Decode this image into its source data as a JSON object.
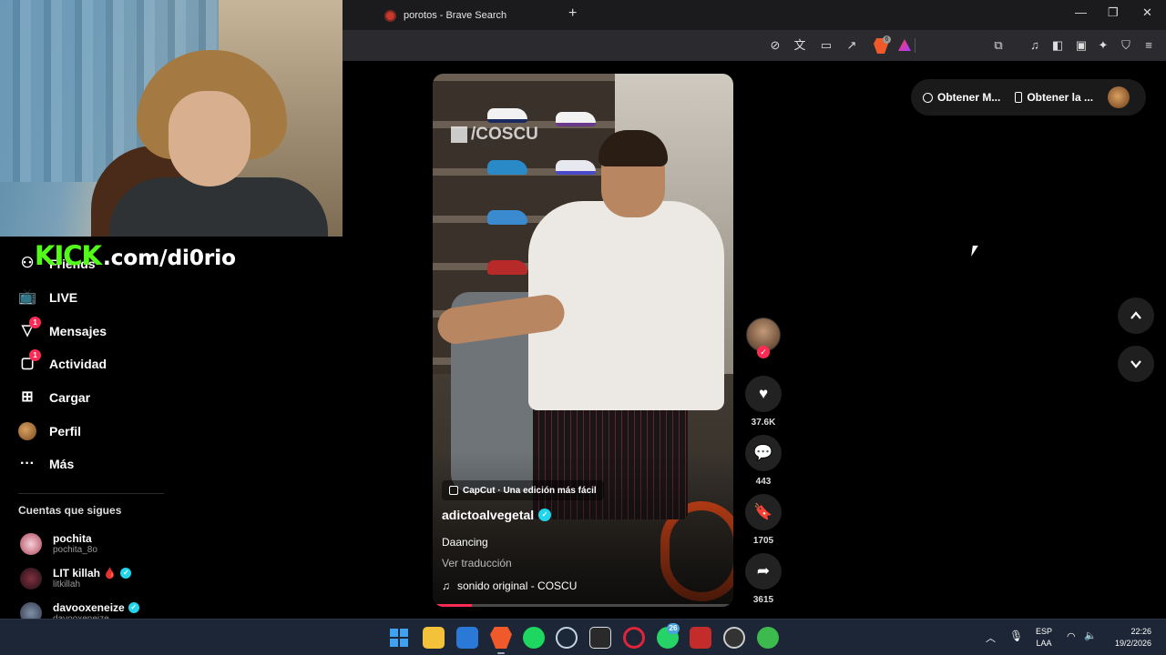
{
  "browser": {
    "tab_title": "porotos - Brave Search",
    "new_tab": "+",
    "minimize": "—",
    "maximize": "❐",
    "close": "✕"
  },
  "stream_overlay": {
    "kick_logo": "KICK",
    "kick_url": ".com/di0rio"
  },
  "sidebar": {
    "items": [
      {
        "label": "Friends",
        "icon": "friends-icon"
      },
      {
        "label": "LIVE",
        "icon": "live-icon"
      },
      {
        "label": "Mensajes",
        "icon": "messages-icon",
        "badge": "1"
      },
      {
        "label": "Actividad",
        "icon": "activity-icon",
        "badge": "1"
      },
      {
        "label": "Cargar",
        "icon": "upload-icon"
      },
      {
        "label": "Perfil",
        "icon": "profile-avatar"
      },
      {
        "label": "Más",
        "icon": "more-icon"
      }
    ],
    "following_title": "Cuentas que sigues",
    "following": [
      {
        "name": "pochita",
        "handle": "pochita_8o"
      },
      {
        "name": "LIT killah 🩸",
        "handle": "litkillah",
        "verified": true
      },
      {
        "name": "davooxeneize",
        "handle": "davooxeneize",
        "verified": true
      }
    ]
  },
  "video": {
    "watermark": "/COSCU",
    "capcut_label": "CapCut · Una edición más fácil",
    "author": "adictoalvegetal",
    "description": "Daancing",
    "translate": "Ver traducción",
    "sound": "sonido original - COSCU",
    "progress": 0.13
  },
  "actions": {
    "likes": "37.6K",
    "comments": "443",
    "saves": "1705",
    "shares": "3615"
  },
  "top_panel": {
    "get_app_1": "Obtener M...",
    "get_app_2": "Obtener la ..."
  },
  "taskbar": {
    "whatsapp_badge": "26",
    "lang_1": "ESP",
    "lang_2": "LAA",
    "time": "22:26",
    "date": "19/2/2026"
  },
  "colors": {
    "accent_red": "#fe2c55",
    "kick_green": "#53fc18",
    "verified_blue": "#20d5ec"
  }
}
